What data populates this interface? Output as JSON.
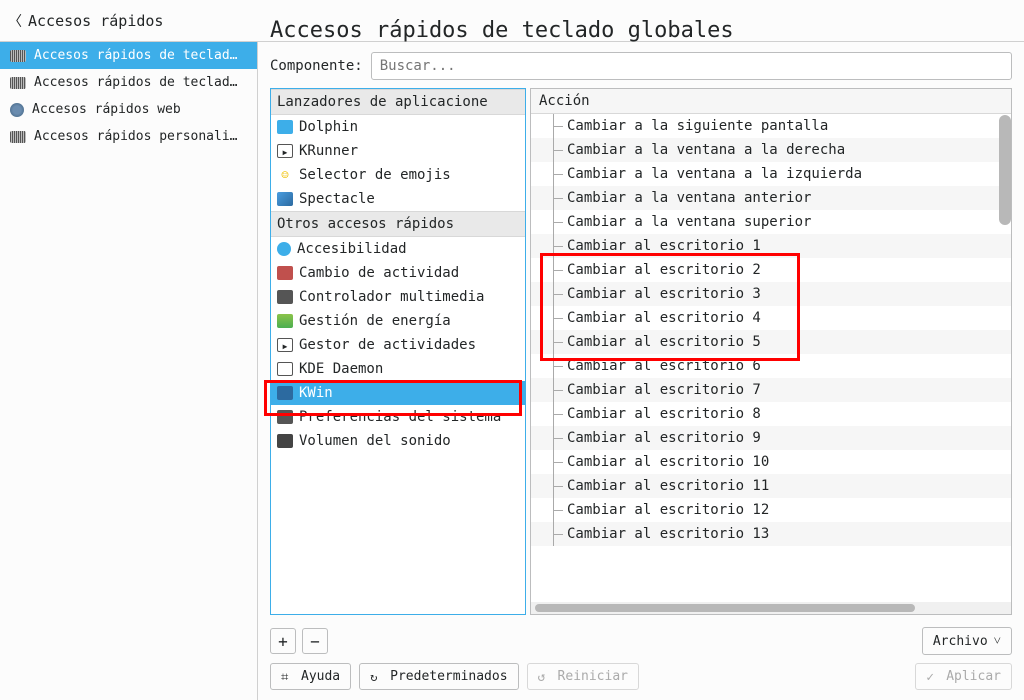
{
  "back_label": "Accesos rápidos",
  "page_title": "Accesos rápidos de teclado globales",
  "leftnav": {
    "items": [
      {
        "label": "Accesos rápidos de teclad…",
        "icon": "kbd"
      },
      {
        "label": "Accesos rápidos de teclad…",
        "icon": "kbd"
      },
      {
        "label": "Accesos rápidos web",
        "icon": "globe"
      },
      {
        "label": "Accesos rápidos personali…",
        "icon": "kbd"
      }
    ],
    "selected": 0
  },
  "componente_label": "Componente:",
  "search_placeholder": "Buscar...",
  "components": {
    "cat1": "Lanzadores de aplicacione",
    "cat1_items": [
      {
        "label": "Dolphin",
        "icon": "folder-ic"
      },
      {
        "label": "KRunner",
        "icon": "run-ic"
      },
      {
        "label": "Selector de emojis",
        "icon": "emoji-ic",
        "glyph": "😀"
      },
      {
        "label": "Spectacle",
        "icon": "spect-ic"
      }
    ],
    "cat2": "Otros accesos rápidos",
    "cat2_items": [
      {
        "label": "Accesibilidad",
        "icon": "access-ic"
      },
      {
        "label": "Cambio de actividad",
        "icon": "activ-ic"
      },
      {
        "label": "Controlador multimedia",
        "icon": "media-ic"
      },
      {
        "label": "Gestión de energía",
        "icon": "power-ic"
      },
      {
        "label": "Gestor de actividades",
        "icon": "gest-ic"
      },
      {
        "label": "KDE Daemon",
        "icon": "daemon-ic"
      },
      {
        "label": "KWin",
        "icon": "kwin-ic"
      },
      {
        "label": "Preferencias del sistema",
        "icon": "prefs-ic"
      },
      {
        "label": "Volumen del sonido",
        "icon": "vol-ic"
      }
    ],
    "selected": "KWin"
  },
  "actions_header": "Acción",
  "actions": [
    "Cambiar a la siguiente pantalla",
    "Cambiar a la ventana a la derecha",
    "Cambiar a la ventana a la izquierda",
    "Cambiar a la ventana anterior",
    "Cambiar a la ventana superior",
    "Cambiar al escritorio 1",
    "Cambiar al escritorio 2",
    "Cambiar al escritorio 3",
    "Cambiar al escritorio 4",
    "Cambiar al escritorio 5",
    "Cambiar al escritorio 6",
    "Cambiar al escritorio 7",
    "Cambiar al escritorio 8",
    "Cambiar al escritorio 9",
    "Cambiar al escritorio 10",
    "Cambiar al escritorio 11",
    "Cambiar al escritorio 12",
    "Cambiar al escritorio 13"
  ],
  "buttons": {
    "archivo": "Archivo",
    "ayuda": "Ayuda",
    "predeterminados": "Predeterminados",
    "reiniciar": "Reiniciar",
    "aplicar": "Aplicar",
    "plus": "+",
    "minus": "−"
  }
}
